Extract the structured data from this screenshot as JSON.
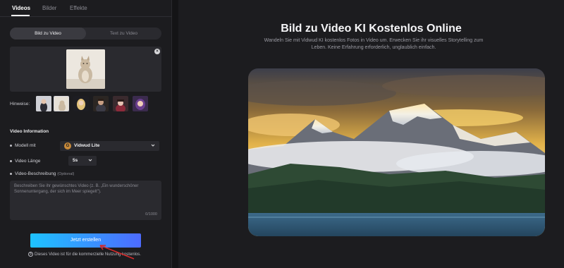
{
  "tabs": [
    {
      "label": "Videos",
      "active": true
    },
    {
      "label": "Bilder",
      "active": false
    },
    {
      "label": "Effekte",
      "active": false
    }
  ],
  "mode": {
    "active": "Bild zu Video",
    "inactive": "Text zu Video"
  },
  "upload": {
    "close_icon": "close-icon",
    "thumbnail": "cat-photo"
  },
  "hints": {
    "label": "Hinweise:",
    "count": 7
  },
  "video_info": {
    "title": "Video Information",
    "model_label": "Modell mit",
    "model_value": "Vidwud Lite",
    "model_icon_letter": "G",
    "length_label": "Video Länge",
    "length_value": "5s",
    "description_label": "Video-Beschreibung",
    "description_optional": "(Optional)",
    "description_placeholder": "Beschreiben Sie ihr gewünschtes Video (z. B. „Ein wunderschöner Sonnenuntergang, der sich im Meer spiegelt\").",
    "description_count": "0/1000"
  },
  "create_button": "Jetzt erstellen",
  "note": "Dieses Video ist für die kommerzielle Nutzung kostenlos.",
  "hero": {
    "title": "Bild zu Video KI Kostenlos Online",
    "subtitle": "Wandeln Sie mit Vidwud KI kostenlos Fotos in Video um. Erwecken Sie ihr visuelles Storytelling zum Leben. Keine Erfahrung erforderlich, unglaublich einfach."
  },
  "colors": {
    "accent_start": "#1ec3ff",
    "accent_end": "#4d6bff",
    "annotation_arrow": "#d22a2a"
  }
}
